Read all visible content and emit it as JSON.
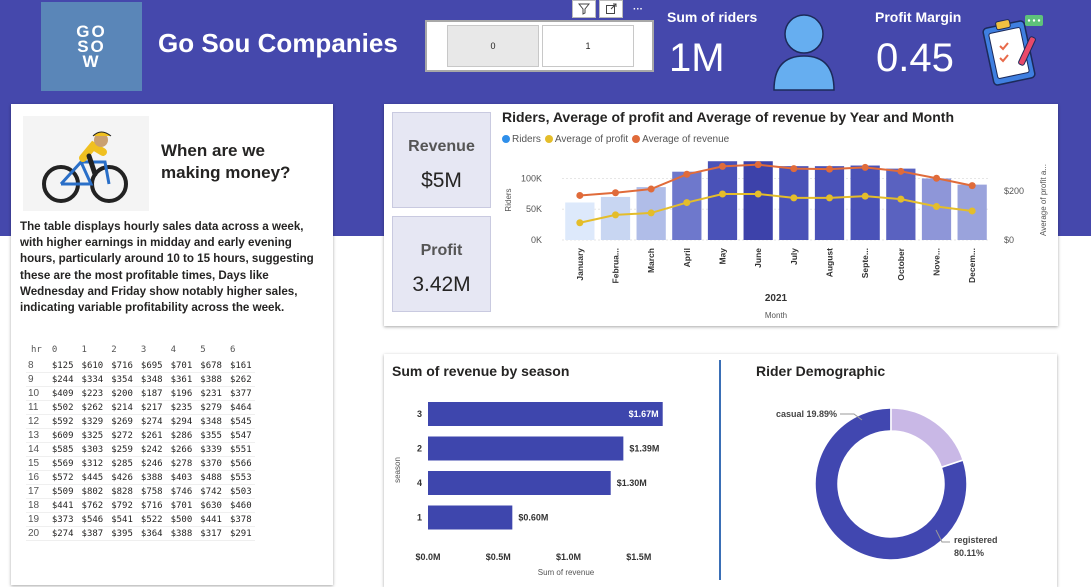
{
  "header": {
    "logo_lines": [
      "GO",
      "SO",
      "W"
    ],
    "company": "Go Sou Companies",
    "slicer": {
      "options": [
        "0",
        "1"
      ],
      "selected": "0"
    },
    "tools": [
      "filter-icon",
      "focus-mode-icon",
      "more-options-icon"
    ],
    "kpis": [
      {
        "title": "Sum of riders",
        "value": "1M",
        "icon": "person-icon"
      },
      {
        "title": "Profit Margin",
        "value": "0.45",
        "icon": "clipboard-icon"
      }
    ]
  },
  "left_panel": {
    "heading": "When are we making money?",
    "description": "The table displays hourly sales data across a week, with higher earnings in midday and early evening hours, particularly around 10 to 15 hours, suggesting these are the most profitable times, Days like Wednesday and Friday show notably higher sales, indicating variable profitability across the week.",
    "table": {
      "corner": "hr",
      "columns": [
        "0",
        "1",
        "2",
        "3",
        "4",
        "5",
        "6"
      ],
      "rows": [
        {
          "hr": "8",
          "values": [
            "$125",
            "$610",
            "$716",
            "$695",
            "$701",
            "$678",
            "$161"
          ]
        },
        {
          "hr": "9",
          "values": [
            "$244",
            "$334",
            "$354",
            "$348",
            "$361",
            "$388",
            "$262"
          ]
        },
        {
          "hr": "10",
          "values": [
            "$409",
            "$223",
            "$200",
            "$187",
            "$196",
            "$231",
            "$377"
          ]
        },
        {
          "hr": "11",
          "values": [
            "$502",
            "$262",
            "$214",
            "$217",
            "$235",
            "$279",
            "$464"
          ]
        },
        {
          "hr": "12",
          "values": [
            "$592",
            "$329",
            "$269",
            "$274",
            "$294",
            "$348",
            "$545"
          ]
        },
        {
          "hr": "13",
          "values": [
            "$609",
            "$325",
            "$272",
            "$261",
            "$286",
            "$355",
            "$547"
          ]
        },
        {
          "hr": "14",
          "values": [
            "$585",
            "$303",
            "$259",
            "$242",
            "$266",
            "$339",
            "$551"
          ]
        },
        {
          "hr": "15",
          "values": [
            "$569",
            "$312",
            "$285",
            "$246",
            "$278",
            "$370",
            "$566"
          ]
        },
        {
          "hr": "16",
          "values": [
            "$572",
            "$445",
            "$426",
            "$388",
            "$403",
            "$488",
            "$553"
          ]
        },
        {
          "hr": "17",
          "values": [
            "$509",
            "$802",
            "$828",
            "$758",
            "$746",
            "$742",
            "$503"
          ]
        },
        {
          "hr": "18",
          "values": [
            "$441",
            "$762",
            "$792",
            "$716",
            "$701",
            "$630",
            "$460"
          ]
        },
        {
          "hr": "19",
          "values": [
            "$373",
            "$546",
            "$541",
            "$522",
            "$500",
            "$441",
            "$378"
          ]
        },
        {
          "hr": "20",
          "values": [
            "$274",
            "$387",
            "$395",
            "$364",
            "$388",
            "$317",
            "$291"
          ]
        }
      ]
    }
  },
  "cards": {
    "revenue": {
      "title": "Revenue",
      "value": "$5M"
    },
    "profit": {
      "title": "Profit",
      "value": "3.42M"
    }
  },
  "chart_data": [
    {
      "type": "bar+line",
      "title": "Riders, Average of profit and Average of revenue by Year and Month",
      "legend": [
        "Riders",
        "Average of profit",
        "Average of revenue"
      ],
      "legend_position": "top-left",
      "categories": [
        "January",
        "Februa...",
        "March",
        "April",
        "May",
        "June",
        "July",
        "August",
        "Septe...",
        "October",
        "Nove...",
        "Decem..."
      ],
      "year_label": "2021",
      "xlabel": "Month",
      "ylabel": "Riders",
      "y2label": "Average of profit a...",
      "y_ticks": [
        "0K",
        "50K",
        "100K"
      ],
      "y2_ticks": [
        "$0",
        "$200"
      ],
      "y_range": [
        0,
        130000
      ],
      "y2_range": [
        0,
        325
      ],
      "series": [
        {
          "name": "Riders",
          "type": "bar",
          "values": [
            61000,
            70000,
            86000,
            111000,
            128000,
            128000,
            120000,
            120000,
            121000,
            116000,
            100000,
            90000
          ]
        },
        {
          "name": "Average of profit",
          "type": "line",
          "values": [
            70,
            102,
            110,
            152,
            187,
            187,
            171,
            171,
            178,
            166,
            136,
            118
          ]
        },
        {
          "name": "Average of revenue",
          "type": "line",
          "values": [
            181,
            192,
            207,
            267,
            299,
            306,
            290,
            288,
            295,
            279,
            251,
            221
          ]
        }
      ],
      "colors": {
        "bars": [
          "#dde9fb",
          "#c8d6f2",
          "#b0bde8",
          "#6e78cc",
          "#4a52b8",
          "#3d42aa",
          "#4a52b8",
          "#4a52b8",
          "#4a52b8",
          "#5a62c0",
          "#8e96d8",
          "#9aa3dc"
        ],
        "profit": "#e4bd2a",
        "revenue": "#e06b3a",
        "legend_riders": "#2f8fea"
      }
    },
    {
      "type": "bar",
      "orientation": "horizontal",
      "title": "Sum of revenue by season",
      "categories": [
        "3",
        "2",
        "4",
        "1"
      ],
      "values": [
        1.67,
        1.39,
        1.3,
        0.6
      ],
      "value_labels": [
        "$1.67M",
        "$1.39M",
        "$1.30M",
        "$0.60M"
      ],
      "xlabel": "Sum of revenue",
      "ylabel": "season",
      "x_ticks": [
        "$0.0M",
        "$0.5M",
        "$1.0M",
        "$1.5M"
      ],
      "xlim": [
        0,
        1.85
      ],
      "color": "#3e46ad"
    },
    {
      "type": "pie",
      "donut": true,
      "title": "Rider Demographic",
      "labels": [
        "registered",
        "casual"
      ],
      "values": [
        80.11,
        19.89
      ],
      "display_labels": [
        "registered 80.11%",
        "casual 19.89%"
      ],
      "label_parts": [
        [
          "registered",
          "80.11%"
        ],
        [
          "casual 19.89%"
        ]
      ],
      "colors": [
        "#4147b0",
        "#c9b8e6"
      ]
    }
  ]
}
